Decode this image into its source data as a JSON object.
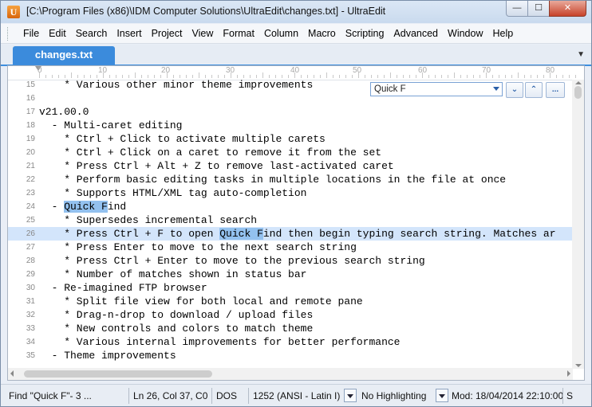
{
  "window": {
    "title": "[C:\\Program Files (x86)\\IDM Computer Solutions\\UltraEdit\\changes.txt] - UltraEdit",
    "app_icon_letter": "U",
    "min_glyph": "—",
    "max_glyph": "☐",
    "close_glyph": "✕"
  },
  "menu": {
    "items": [
      "File",
      "Edit",
      "Search",
      "Insert",
      "Project",
      "View",
      "Format",
      "Column",
      "Macro",
      "Scripting",
      "Advanced",
      "Window",
      "Help"
    ]
  },
  "tabs": {
    "active_label": "changes.txt",
    "dropdown_glyph": "▼"
  },
  "ruler": {
    "labels": [
      "0",
      "10",
      "20",
      "30",
      "40",
      "50",
      "60",
      "70",
      "80"
    ]
  },
  "quick_find": {
    "value": "Quick F",
    "down_glyph": "⌄",
    "up_glyph": "⌃",
    "more_glyph": "..."
  },
  "lines": [
    {
      "num": "15",
      "text": "    * Various other minor theme improvements"
    },
    {
      "num": "16",
      "text": ""
    },
    {
      "num": "17",
      "text": "v21.00.0"
    },
    {
      "num": "18",
      "text": "  - Multi-caret editing"
    },
    {
      "num": "19",
      "text": "    * Ctrl + Click to activate multiple carets"
    },
    {
      "num": "20",
      "text": "    * Ctrl + Click on a caret to remove it from the set"
    },
    {
      "num": "21",
      "text": "    * Press Ctrl + Alt + Z to remove last-activated caret"
    },
    {
      "num": "22",
      "text": "    * Perform basic editing tasks in multiple locations in the file at once"
    },
    {
      "num": "23",
      "text": "    * Supports HTML/XML tag auto-completion"
    },
    {
      "num": "24",
      "pre": "  - ",
      "hl": "Quick F",
      "post": "ind"
    },
    {
      "num": "25",
      "text": "    * Supersedes incremental search"
    },
    {
      "num": "26",
      "pre": "    * Press Ctrl + F to open ",
      "hl": "Quick F",
      "post": "ind then begin typing search string. Matches ar",
      "current": true
    },
    {
      "num": "27",
      "text": "    * Press Enter to move to the next search string"
    },
    {
      "num": "28",
      "text": "    * Press Ctrl + Enter to move to the previous search string"
    },
    {
      "num": "29",
      "text": "    * Number of matches shown in status bar"
    },
    {
      "num": "30",
      "text": "  - Re-imagined FTP browser"
    },
    {
      "num": "31",
      "text": "    * Split file view for both local and remote pane"
    },
    {
      "num": "32",
      "text": "    * Drag-n-drop to download / upload files"
    },
    {
      "num": "33",
      "text": "    * New controls and colors to match theme"
    },
    {
      "num": "34",
      "text": "    * Various internal improvements for better performance"
    },
    {
      "num": "35",
      "text": "  - Theme improvements"
    }
  ],
  "status": {
    "find": "Find \"Quick F\"- 3 ...",
    "position": "Ln 26, Col 37, C0",
    "line_ending": "DOS",
    "encoding": "1252  (ANSI - Latin I)",
    "highlighting": "No Highlighting",
    "modified": "Mod: 18/04/2014 22:10:00",
    "extra": "S"
  },
  "colors": {
    "tab_active": "#3b8bdc",
    "current_line": "#d3e5fb",
    "match_highlight": "#93c1ef"
  }
}
